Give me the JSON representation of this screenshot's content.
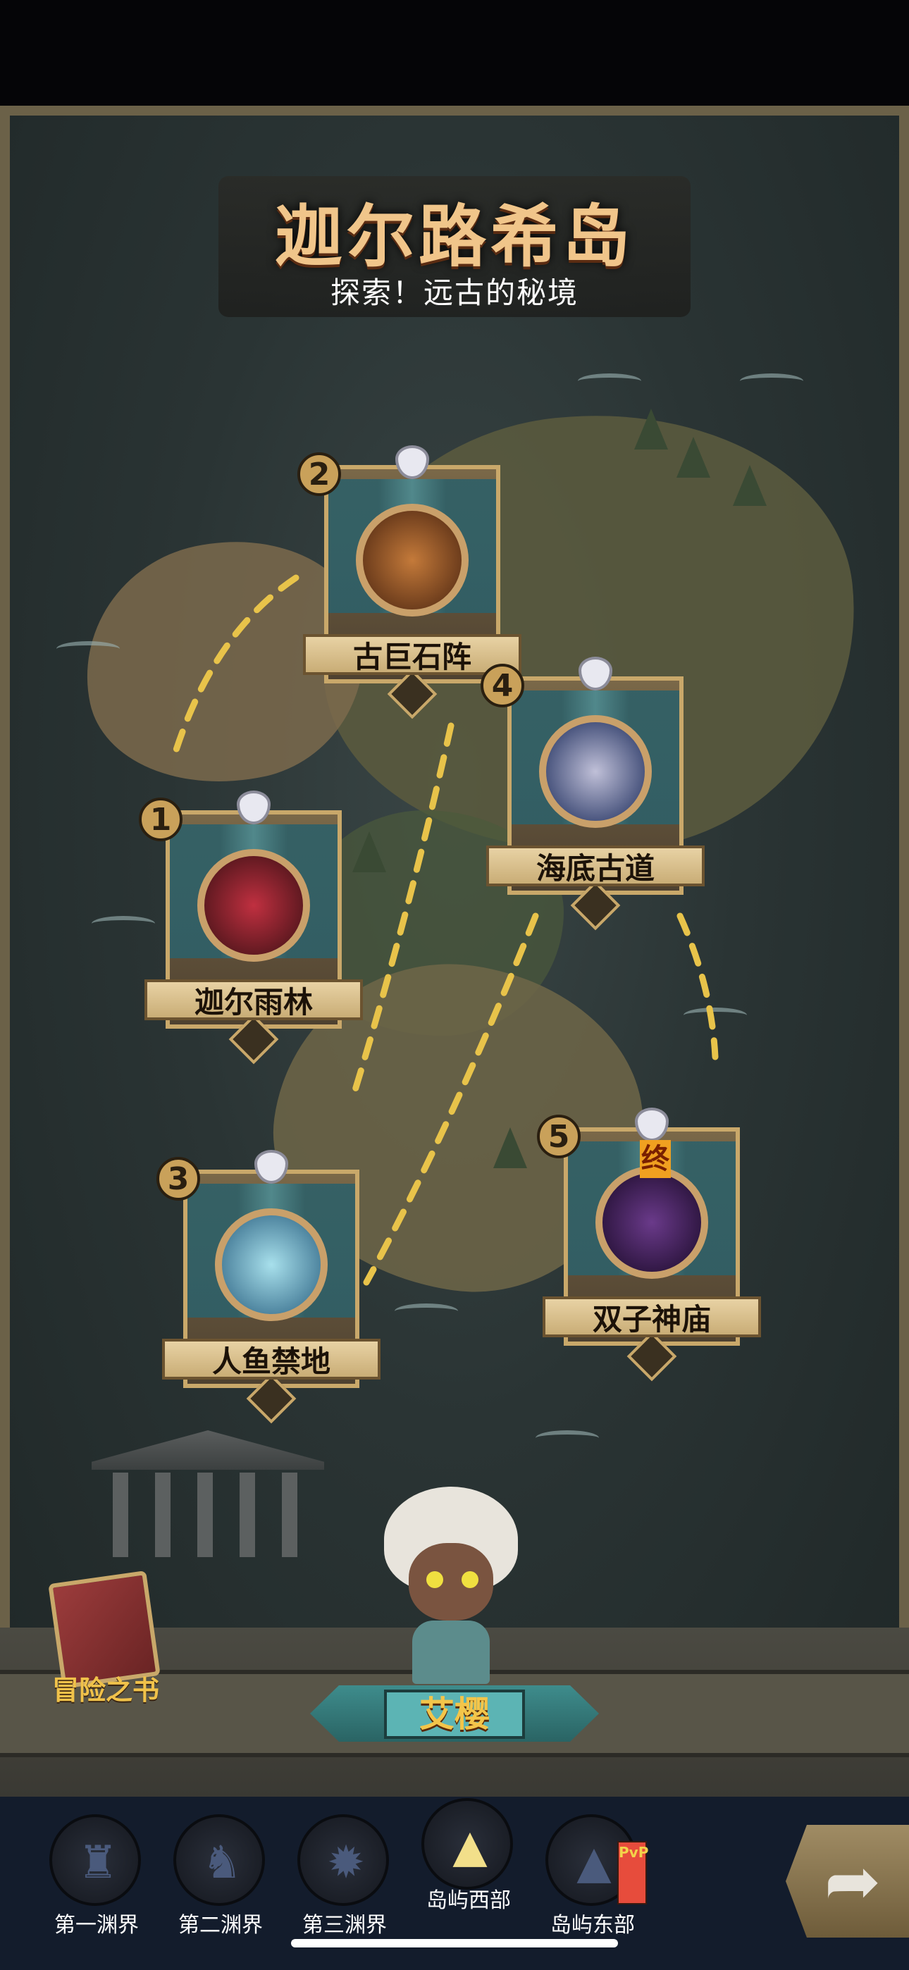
{
  "map": {
    "title": "迦尔路希岛",
    "subtitle": "探索！远古的秘境"
  },
  "stages": [
    {
      "number": "1",
      "name": "迦尔雨林",
      "portrait_color": "#8a2a30"
    },
    {
      "number": "2",
      "name": "古巨石阵",
      "portrait_color": "#9a5a2a"
    },
    {
      "number": "3",
      "name": "人鱼禁地",
      "portrait_color": "#5ab0c8"
    },
    {
      "number": "4",
      "name": "海底古道",
      "portrait_color": "#2a3a6a"
    },
    {
      "number": "5",
      "name": "双子神庙",
      "portrait_color": "#3a2050",
      "final_badge": "终"
    }
  ],
  "adventure_book": {
    "label": "冒险之书",
    "icon": "book-icon"
  },
  "hero": {
    "name": "艾樱"
  },
  "bottom_nav": {
    "items": [
      {
        "label": "第一渊界",
        "icon": "abyss-demon-icon",
        "active": false
      },
      {
        "label": "第二渊界",
        "icon": "abyss-horned-icon",
        "active": false
      },
      {
        "label": "第三渊界",
        "icon": "abyss-spiked-icon",
        "active": false
      },
      {
        "label": "岛屿西部",
        "icon": "island-rock-icon",
        "active": true
      },
      {
        "label": "岛屿东部",
        "icon": "island-rock-icon",
        "active": false,
        "badge": "PvP"
      }
    ],
    "go_button_icon": "forward-arrow-icon"
  },
  "colors": {
    "accent_gold": "#f0c58a",
    "nav_bg": "#131c2c",
    "ribbon_teal": "#3e8c8c"
  }
}
